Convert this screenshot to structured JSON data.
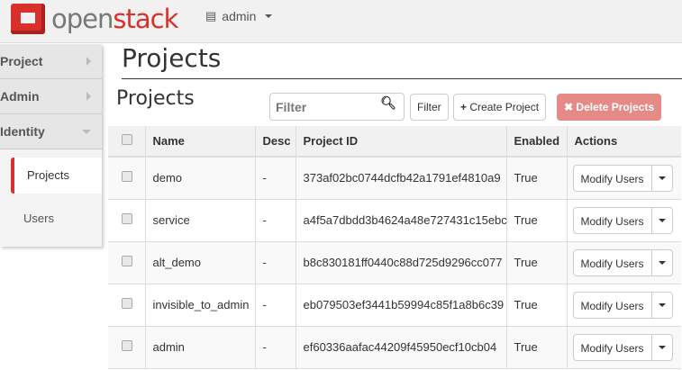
{
  "brand": {
    "open": "open",
    "stack": "stack"
  },
  "project_menu": {
    "label": "admin",
    "icon": "project-list-icon"
  },
  "sidebar": {
    "dashboards": [
      {
        "label": "Project"
      },
      {
        "label": "Admin"
      },
      {
        "label": "Identity"
      }
    ],
    "panels": [
      {
        "label": "Projects",
        "active": true
      },
      {
        "label": "Users"
      }
    ]
  },
  "page_title": "Projects",
  "table": {
    "title": "Projects",
    "filter_placeholder": "Filter",
    "filter_button": "Filter",
    "create_button": "Create Project",
    "delete_button": "Delete Projects",
    "columns": [
      "Name",
      "Desc",
      "Project ID",
      "Enabled",
      "Actions"
    ],
    "rows": [
      {
        "name": "demo",
        "desc": "-",
        "id": "373af02bc0744dcfb42a1791ef4810a9",
        "enabled": "True",
        "action": "Modify Users"
      },
      {
        "name": "service",
        "desc": "-",
        "id": "a4f5a7dbdd3b4624a48e727431c15ebc",
        "enabled": "True",
        "action": "Modify Users"
      },
      {
        "name": "alt_demo",
        "desc": "-",
        "id": "b8c830181ff0440c88d725d9296cc077",
        "enabled": "True",
        "action": "Modify Users"
      },
      {
        "name": "invisible_to_admin",
        "desc": "-",
        "id": "eb079503ef3441b59994c85f1a8b6c39",
        "enabled": "True",
        "action": "Modify Users"
      },
      {
        "name": "admin",
        "desc": "-",
        "id": "ef60336aafac44209f45950ecf10cb04",
        "enabled": "True",
        "action": "Modify Users"
      }
    ]
  },
  "colors": {
    "brand": "#d9302b",
    "danger": "#e68a87"
  }
}
